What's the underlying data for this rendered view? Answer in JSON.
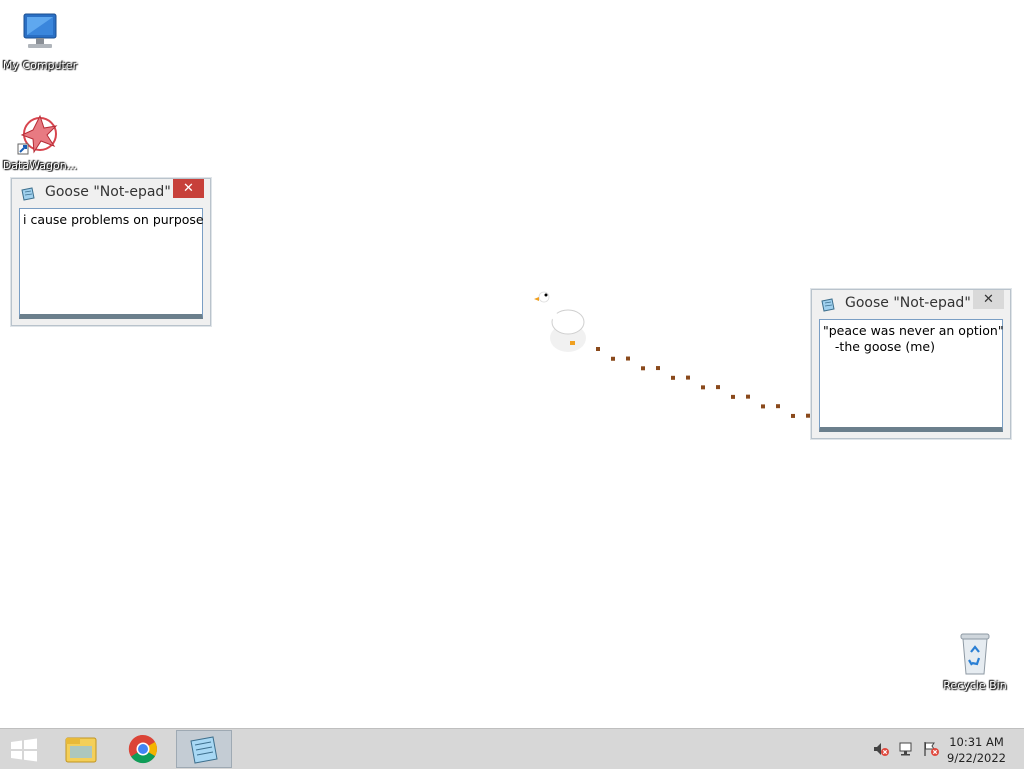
{
  "desktop": {
    "icons": [
      {
        "label": "My Computer",
        "icon": "computer-icon"
      },
      {
        "label": "DataWagon...",
        "icon": "datawagon-icon"
      },
      {
        "label": "Recycle Bin",
        "icon": "recycle-bin-icon"
      }
    ]
  },
  "windows": [
    {
      "title": "Goose \"Not-epad\"",
      "close": "✕",
      "text": "i cause problems on purpose"
    },
    {
      "title": "Goose \"Not-epad\"",
      "close": "✕",
      "text": "\"peace was never an option\"\n   -the goose (me)"
    }
  ],
  "taskbar": {
    "start": "start-icon",
    "pinned": [
      "file-explorer-icon",
      "chrome-icon",
      "notepad-icon"
    ],
    "tray": [
      "volume-muted-icon",
      "network-icon",
      "action-center-flag-icon"
    ],
    "time": "10:31 AM",
    "date": "9/22/2022"
  },
  "colors": {
    "close_button": "#c7403a",
    "taskbar": "#d7d7d7",
    "footprints": "#8a4a1c"
  }
}
